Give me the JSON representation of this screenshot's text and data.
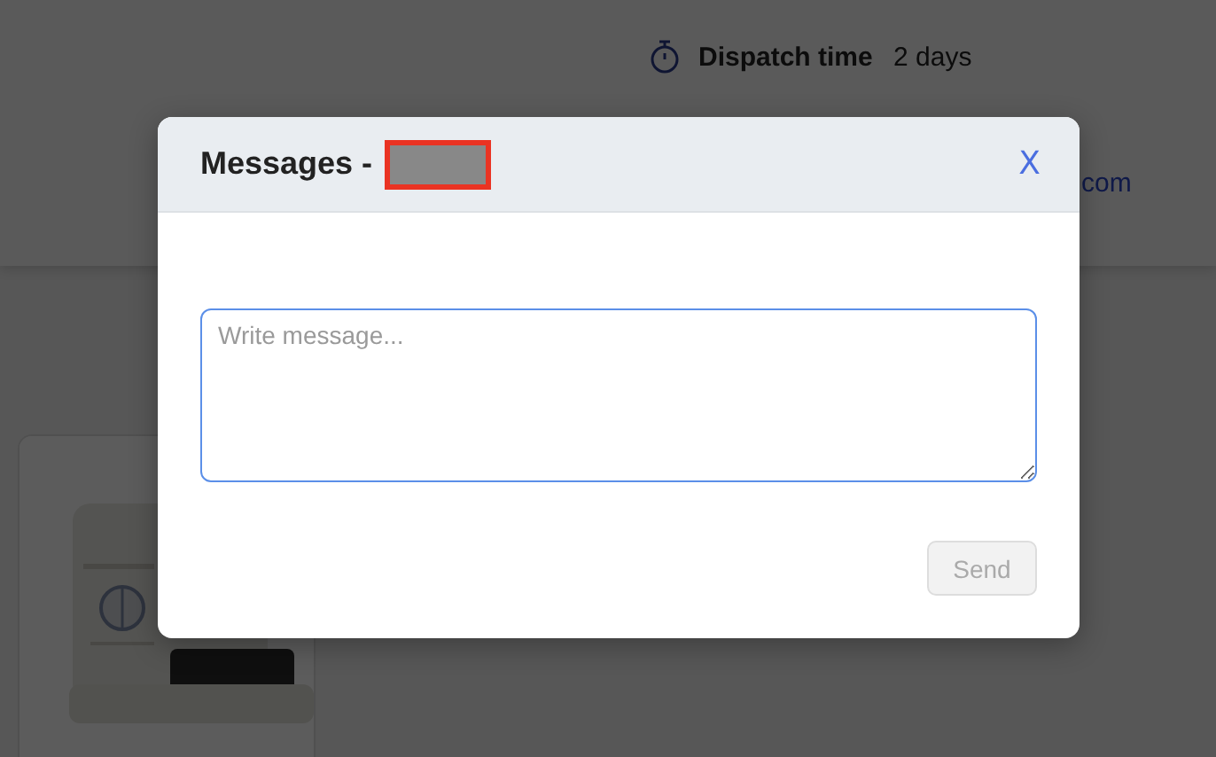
{
  "background_page": {
    "details": [
      {
        "label": "Dispatch time",
        "value": "2 days"
      }
    ],
    "link_fragment": "com"
  },
  "modal": {
    "title": "Messages - ",
    "redacted": true,
    "close": "X",
    "message": {
      "placeholder": "Write message..."
    },
    "send": {
      "label": "Send",
      "disabled": true
    }
  }
}
